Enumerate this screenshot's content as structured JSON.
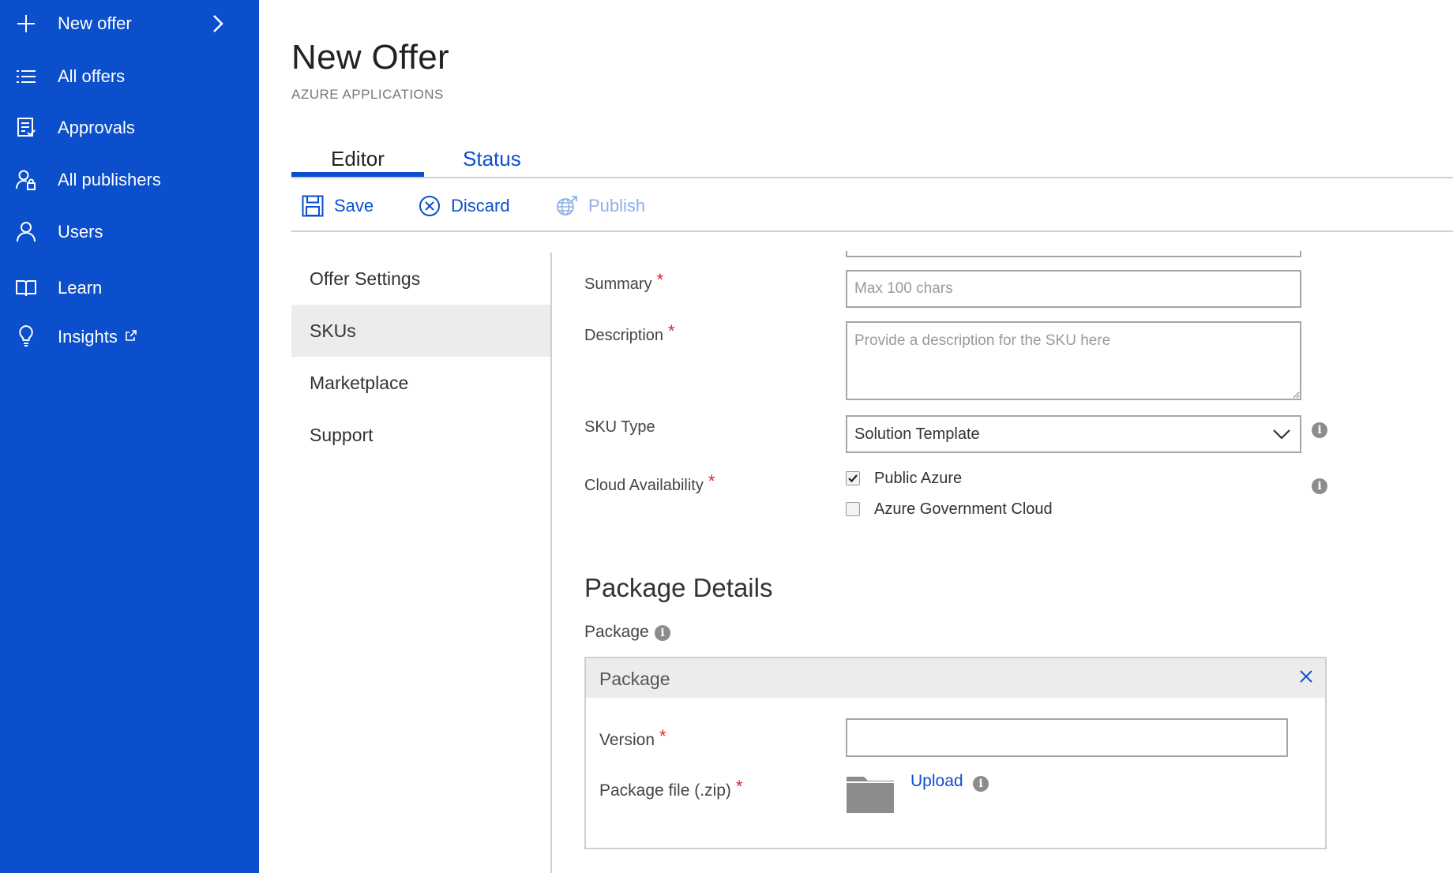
{
  "sidebar": {
    "items": [
      {
        "label": "New offer",
        "icon": "plus-icon"
      },
      {
        "label": "All offers",
        "icon": "list-icon"
      },
      {
        "label": "Approvals",
        "icon": "approvals-icon"
      },
      {
        "label": "All publishers",
        "icon": "publishers-icon"
      },
      {
        "label": "Users",
        "icon": "user-icon"
      },
      {
        "label": "Learn",
        "icon": "book-icon"
      },
      {
        "label": "Insights",
        "icon": "lightbulb-icon"
      }
    ]
  },
  "header": {
    "title": "New Offer",
    "subtitle": "AZURE APPLICATIONS"
  },
  "tabs": [
    {
      "label": "Editor",
      "active": true
    },
    {
      "label": "Status",
      "active": false
    }
  ],
  "toolbar": {
    "save_label": "Save",
    "discard_label": "Discard",
    "publish_label": "Publish"
  },
  "subnav": [
    {
      "label": "Offer Settings"
    },
    {
      "label": "SKUs",
      "active": true
    },
    {
      "label": "Marketplace"
    },
    {
      "label": "Support"
    }
  ],
  "form": {
    "summary": {
      "label": "Summary",
      "required": "*",
      "placeholder": "Max 100 chars",
      "value": ""
    },
    "description": {
      "label": "Description",
      "required": "*",
      "placeholder": "Provide a description for the SKU here",
      "value": ""
    },
    "sku_type": {
      "label": "SKU Type",
      "value": "Solution Template"
    },
    "cloud_availability": {
      "label": "Cloud Availability",
      "required": "*",
      "options": [
        {
          "label": "Public Azure",
          "checked": true
        },
        {
          "label": "Azure Government Cloud",
          "checked": false
        }
      ]
    }
  },
  "package_details": {
    "section_title": "Package Details",
    "package_label": "Package",
    "box_title": "Package",
    "version": {
      "label": "Version",
      "required": "*",
      "value": ""
    },
    "package_file": {
      "label": "Package file (.zip)",
      "required": "*",
      "upload_label": "Upload"
    }
  },
  "colors": {
    "sidebar_bg": "#0b4fcc",
    "accent": "#0b4fcc",
    "required": "#e0242e",
    "disabled": "#8fb0e6"
  },
  "info_glyph": "i"
}
